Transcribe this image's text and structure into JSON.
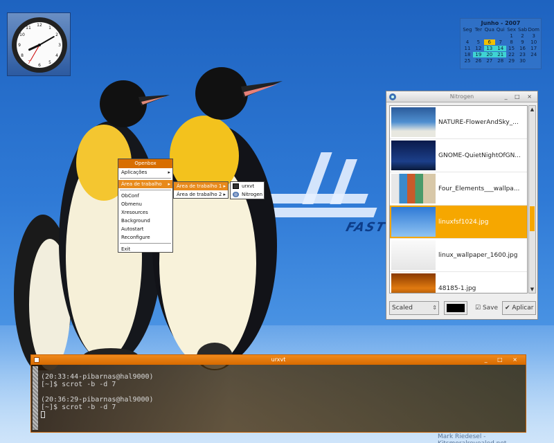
{
  "clock": {
    "hours": 8,
    "minutes": 10,
    "seconds": 35
  },
  "calendar": {
    "title": "Junho - 2007",
    "weekdays": [
      "Seg",
      "Ter",
      "Qua",
      "Qui",
      "Sex",
      "Sab",
      "Dom"
    ],
    "days": [
      [
        "",
        "",
        "",
        "",
        "1",
        "2",
        "3"
      ],
      [
        "4",
        "5",
        "6",
        "7",
        "8",
        "9",
        "10"
      ],
      [
        "11",
        "12",
        "13",
        "14",
        "15",
        "16",
        "17"
      ],
      [
        "18",
        "19",
        "20",
        "21",
        "22",
        "23",
        "24"
      ],
      [
        "25",
        "26",
        "27",
        "28",
        "29",
        "30",
        ""
      ]
    ],
    "highlight_day": "6",
    "highlight_cyan": [
      "13",
      "14",
      "19",
      "20",
      "21"
    ]
  },
  "wallpaper": {
    "brand_text": "FAST"
  },
  "openbox_menu": {
    "title": "Openbox",
    "items": [
      {
        "label": "Aplicações",
        "arrow": "▸"
      },
      {
        "label": "Área de trabalho",
        "arrow": "▸"
      },
      {
        "label": "ObConf"
      },
      {
        "label": "Obmenu"
      },
      {
        "label": "Xresources"
      },
      {
        "label": "Background"
      },
      {
        "label": "Autostart"
      },
      {
        "label": "Reconfigure"
      },
      {
        "label": "Exit"
      }
    ],
    "submenu1": [
      {
        "label": "Área de trabalho 1",
        "arrow": "▸"
      },
      {
        "label": "Área de trabalho 2",
        "arrow": "▸"
      }
    ],
    "submenu2": [
      {
        "label": "urxvt"
      },
      {
        "label": "Nitrogen"
      }
    ]
  },
  "nitrogen": {
    "title": "Nitrogen",
    "window_buttons": "_ □ ×",
    "files": [
      {
        "name": "NATURE-FlowerAndSky_..."
      },
      {
        "name": "GNOME-QuietNightOfGN..."
      },
      {
        "name": "Four_Elements___wallpa..."
      },
      {
        "name": "linuxfsf1024.jpg",
        "selected": true
      },
      {
        "name": "linux_wallpaper_1600.jpg"
      },
      {
        "name": "48185-1.jpg"
      }
    ],
    "mode": "Scaled",
    "save_label": "Save",
    "apply_label": "Aplicar",
    "background_color": "#000000",
    "accent": "#f6a700"
  },
  "urxvt": {
    "title": "urxvt",
    "window_buttons": "_ □ ×",
    "lines": [
      "(20:33:44-pibarnas@hal9000)",
      "[~]$ scrot -b -d 7",
      "",
      "(20:36:29-pibarnas@hal9000)",
      "[~]$ scrot -b -d 7"
    ]
  },
  "credit": "Mark Riedesel - Kitsmoralrevealed.net"
}
